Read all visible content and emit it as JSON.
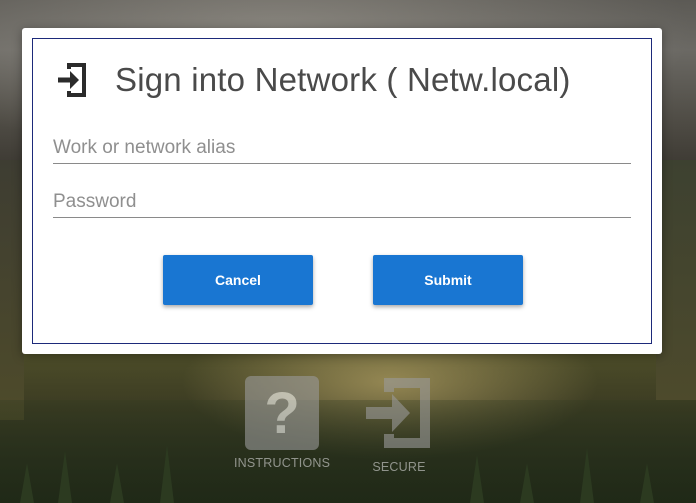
{
  "dialog": {
    "title": "Sign into Network ( Netw.local)",
    "icon": "sign-in-icon",
    "alias_field": {
      "placeholder": "Work or network alias",
      "value": ""
    },
    "password_field": {
      "placeholder": "Password",
      "value": ""
    },
    "cancel_label": "Cancel",
    "submit_label": "Submit"
  },
  "footer_links": {
    "instructions": {
      "label": "INSTRUCTIONS",
      "icon": "question-mark-icon"
    },
    "secure": {
      "label": "SECURE",
      "icon": "sign-in-icon"
    }
  },
  "colors": {
    "accent": "#1976d2",
    "dialog_border": "#1d2a7a",
    "title_text": "#4a4a4a"
  }
}
